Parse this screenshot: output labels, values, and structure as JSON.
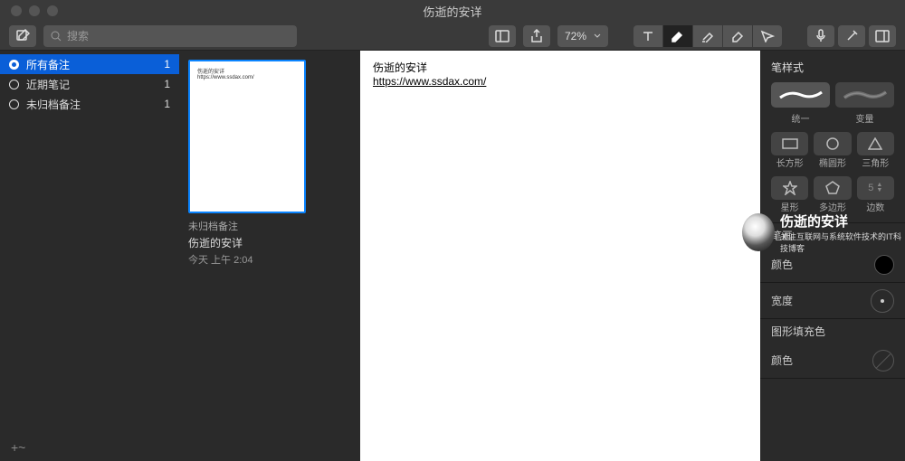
{
  "window": {
    "title": "伤逝的安详"
  },
  "toolbar": {
    "search_placeholder": "搜索",
    "zoom": "72%"
  },
  "sidebar": {
    "items": [
      {
        "label": "所有备注",
        "count": "1",
        "active": true
      },
      {
        "label": "近期笔记",
        "count": "1",
        "active": false
      },
      {
        "label": "未归档备注",
        "count": "1",
        "active": false
      }
    ],
    "add_symbol": "+~"
  },
  "notes": {
    "thumb_line1": "伤逝的安详",
    "thumb_line2": "https://www.ssdax.com/",
    "meta": "未归档备注",
    "title": "伤逝的安详",
    "date": "今天 上午 2:04"
  },
  "editor": {
    "line1": "伤逝的安详",
    "link": "https://www.ssdax.com/"
  },
  "inspector": {
    "pen_style": "笔样式",
    "uniform": "统一",
    "variable": "变量",
    "rectangle": "长方形",
    "ellipse": "椭圆形",
    "triangle": "三角形",
    "star": "星形",
    "polygon": "多边形",
    "sides": "边数",
    "sides_value": "5",
    "stroke": "笔画",
    "color": "颜色",
    "width": "宽度",
    "shape_fill": "图形填充色"
  },
  "watermark": {
    "title": "伤逝的安详",
    "subtitle": "关注互联网与系统软件技术的IT科技博客"
  }
}
